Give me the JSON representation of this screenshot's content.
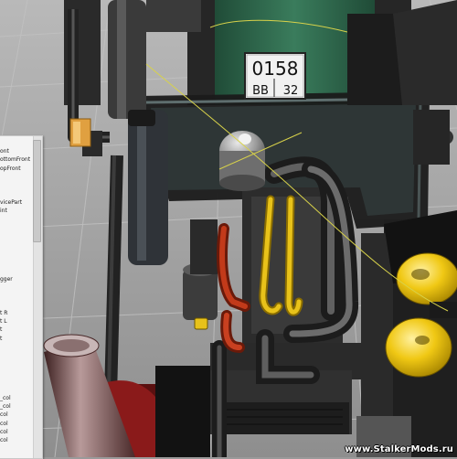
{
  "scene": {
    "license_plate": {
      "number": "0158",
      "region_letters": "BB",
      "region_code": "32"
    }
  },
  "scene_tree_panel": {
    "items": [
      "ont",
      "ottomFront",
      "opFront",
      "",
      "",
      "",
      "vicePart",
      "int",
      "",
      "",
      "",
      "",
      "",
      "",
      "",
      "gger",
      "",
      "",
      "",
      "t R",
      "t L",
      "t",
      "t",
      "",
      "",
      "",
      "",
      "",
      "",
      "_col",
      "_col",
      "col",
      "col",
      "col",
      "col"
    ]
  },
  "watermark": "www.StalkerMods.ru",
  "colors": {
    "background": "#9a9a9a",
    "grid_lines": "#b4b4b4",
    "cab_green": "#2f6b4f",
    "engine_block": "#3a3a3a",
    "manifold_yellow": "#e8c21a",
    "tank_yellow": "#f0c814",
    "tube_red": "#c23a1a",
    "gizmo_line": "#d8d24a"
  }
}
